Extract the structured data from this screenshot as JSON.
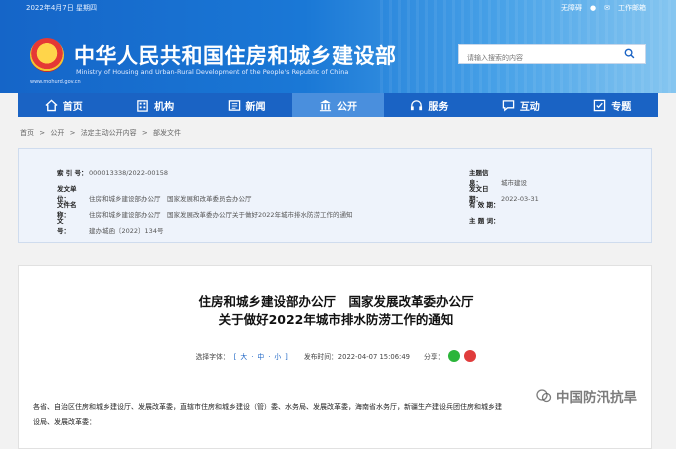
{
  "header": {
    "date": "2022年4月7日 星期四",
    "top_links": [
      {
        "label": "无障碍",
        "icon": "accessibility-icon"
      },
      {
        "label": "",
        "icon": "wechat-icon"
      },
      {
        "label": "工作邮箱",
        "icon": "mail-icon"
      }
    ],
    "title": "中华人民共和国住房和城乡建设部",
    "subtitle": "Ministry of Housing and Urban-Rural Development of the People's Republic of China",
    "url": "www.mohurd.gov.cn",
    "search_placeholder": "请输入搜索的内容"
  },
  "nav": [
    {
      "label": "首页",
      "icon": "home-icon",
      "active": false
    },
    {
      "label": "机构",
      "icon": "building-icon",
      "active": false
    },
    {
      "label": "新闻",
      "icon": "news-icon",
      "active": false
    },
    {
      "label": "公开",
      "icon": "columns-icon",
      "active": true
    },
    {
      "label": "服务",
      "icon": "service-icon",
      "active": false
    },
    {
      "label": "互动",
      "icon": "chat-icon",
      "active": false
    },
    {
      "label": "专题",
      "icon": "topic-icon",
      "active": false
    }
  ],
  "breadcrumb": [
    "首页",
    ">",
    "公开",
    ">",
    "法定主动公开内容",
    ">",
    "部发文件"
  ],
  "meta": {
    "index_label": "索 引 号：",
    "index_value": "000013338/2022-00158",
    "issuer_label": "发文单位：",
    "issuer_value": "住房和城乡建设部办公厅　国家发展和改革委员会办公厅",
    "docname_label": "文件名称：",
    "docname_value": "住房和城乡建设部办公厅　国家发展改革委办公厅关于做好2022年城市排水防涝工作的通知",
    "docnum_label": "文　　号：",
    "docnum_value": "建办城函〔2022〕134号",
    "topic_label": "主题信息：",
    "topic_value": "城市建设",
    "date_label": "发文日期：",
    "date_value": "2022-03-31",
    "validity_label": "有 效 期：",
    "validity_value": "",
    "keywords_label": "主 题 词：",
    "keywords_value": ""
  },
  "article": {
    "title_line1": "住房和城乡建设部办公厅　国家发展改革委办公厅",
    "title_line2": "关于做好2022年城市排水防涝工作的通知",
    "font_label": "选择字体：",
    "font_options": [
      "[",
      "大",
      "·",
      "中",
      "·",
      "小",
      "]"
    ],
    "publish_label": "发布时间：",
    "publish_time": "2022-04-07 15:06:49",
    "share_label": "分享：",
    "body_line1": "各省、自治区住房和城乡建设厅、发展改革委，直辖市住房和城乡建设（管）委、水务局、发展改革委，海南省水务厅，新疆生产建设兵团住房和城乡建",
    "body_line2": "设局、发展改革委："
  },
  "watermark": {
    "text": "中国防汛抗旱"
  },
  "colors": {
    "header_blue": "#1565c8",
    "nav_blue": "#1a63c4",
    "nav_active": "#4a8fdd"
  }
}
